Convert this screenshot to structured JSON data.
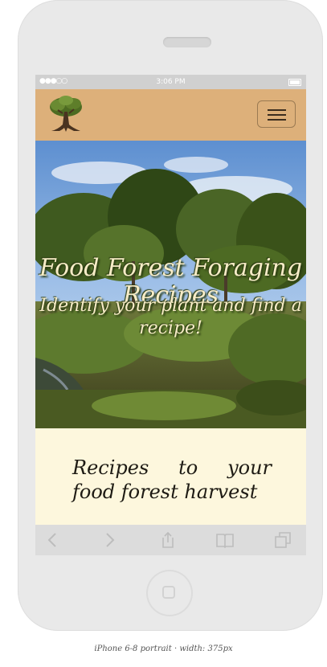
{
  "device": {
    "status_time": "3:06 PM",
    "signal": "●●●○○",
    "caption": "iPhone 6-8 portrait · width: 375px"
  },
  "navbar": {
    "logo_icon": "tree-icon",
    "menu_icon": "hamburger-icon",
    "background": "#ddb07a"
  },
  "hero": {
    "title": "Food Forest Foraging Recipes",
    "subtitle": "Identify your plant and find a recipe!"
  },
  "main": {
    "heading": "Recipes to your food forest harvest",
    "background": "#fdf7dd"
  },
  "browser_toolbar": {
    "icons": [
      "back-icon",
      "forward-icon",
      "share-icon",
      "bookmarks-icon",
      "tabs-icon"
    ]
  }
}
